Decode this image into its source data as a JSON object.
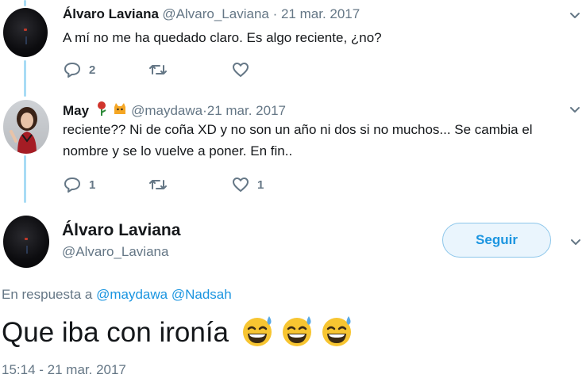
{
  "tweets": [
    {
      "name": "Álvaro Laviana",
      "handle": "@Alvaro_Laviana",
      "sep": " · ",
      "date": "21 mar. 2017",
      "text": "A mí no me ha quedado claro. Es algo reciente, ¿no?",
      "replies": "2",
      "retweets": "",
      "likes": ""
    },
    {
      "name": "May",
      "handle": "@maydawa",
      "sep": " · ",
      "date": "21 mar. 2017",
      "text_line1": "reciente?? Ni de coña XD y no son un año ni dos si no muchos... Se cambia el",
      "text_line2": "nombre y se lo vuelve a poner. En fin..",
      "replies": "1",
      "retweets": "",
      "likes": "1"
    }
  ],
  "main_tweet": {
    "name": "Álvaro Laviana",
    "handle": "@Alvaro_Laviana",
    "follow_label": "Seguir",
    "reply_prefix": "En respuesta a",
    "reply_to": [
      "@maydawa",
      "@Nadsah"
    ],
    "text": "Que iba con ironía",
    "timestamp": "15:14 - 21 mar. 2017"
  },
  "icons": [
    "reply-icon",
    "retweet-icon",
    "like-icon",
    "chevron-down-icon"
  ],
  "colors": {
    "accent": "#1b95e0",
    "muted": "#657786",
    "thread": "#a8dcf5"
  }
}
